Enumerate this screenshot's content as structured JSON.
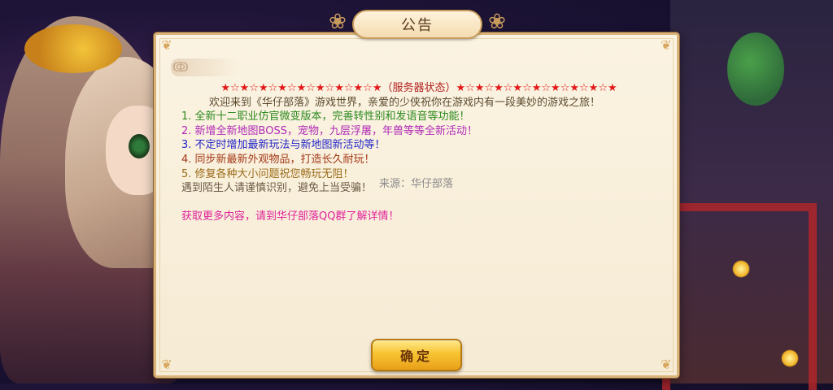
{
  "dialog": {
    "title": "公告",
    "status_line_left_stars": "★☆★☆★☆★☆★☆★☆★☆★☆★",
    "status_text": "（服务器状态）",
    "status_line_right_stars": "★☆★☆★☆★☆★☆★☆★☆★☆★",
    "welcome": "欢迎来到《华仔部落》游戏世界，亲爱的少侠祝你在游戏内有一段美妙的游戏之旅！",
    "items": [
      "1. 全新十二职业仿官微变版本，完善转性别和发语音等功能！",
      "2. 新增全新地图BOSS，宠物，九层浮屠，年兽等等全新活动！",
      "3. 不定时增加最新玩法与新地图新活动等！",
      "4. 同步新最新外观物品，打造长久耐玩！",
      "5. 修复各种大小问题祝您畅玩无阻！"
    ],
    "warning": "遇到陌生人请谨慎识别，避免上当受骗！",
    "cta": "获取更多内容，请到华仔部落QQ群了解详情！",
    "watermark": "来源：华仔部落",
    "ok_button": "确定"
  },
  "icons": {
    "lotus_left": "lotus-ornament-icon",
    "lotus_right": "lotus-ornament-icon",
    "cloud": "cloud-swirl-icon"
  },
  "colors": {
    "panel_bg": "#f6ebd4",
    "panel_border": "#d9b47a",
    "item_1": "#2b8a1f",
    "item_2": "#b02ab8",
    "item_3": "#2327c8",
    "item_4": "#a33a18",
    "item_5": "#9a6a18",
    "cta": "#e0209a",
    "button": "#f7c332"
  }
}
